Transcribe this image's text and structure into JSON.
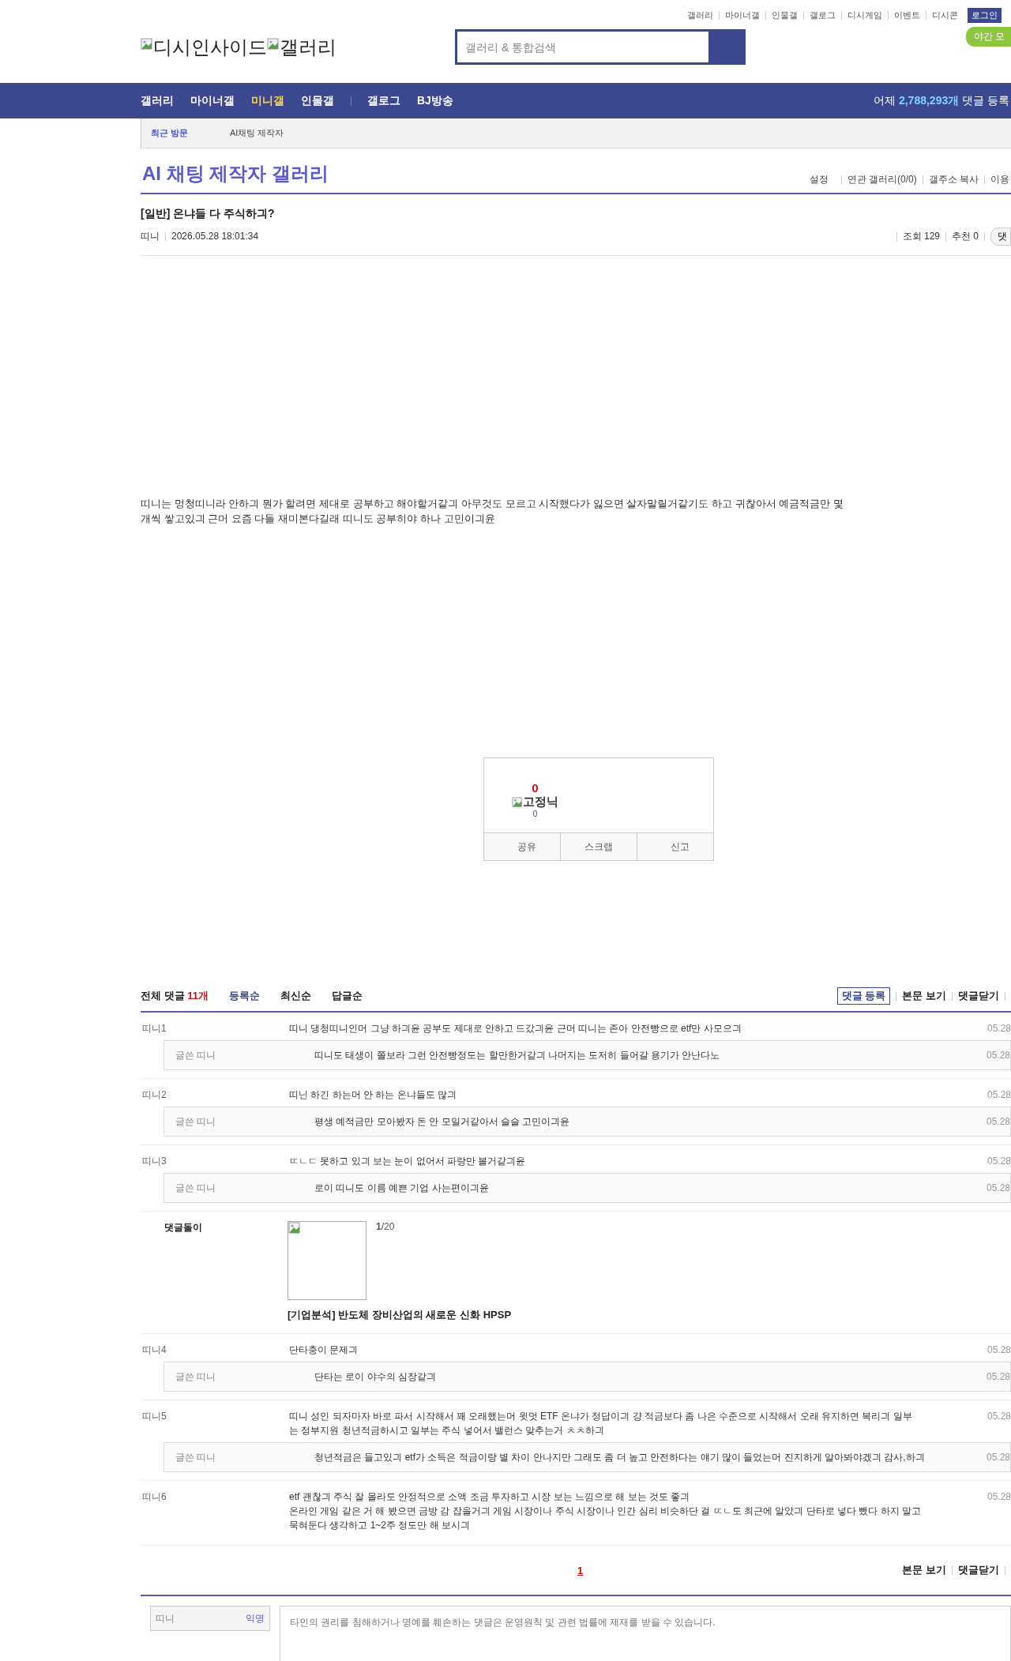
{
  "top_links": [
    "갤러리",
    "마이너갤",
    "인물갤",
    "갤로그",
    "디시게임",
    "이벤트",
    "디시콘"
  ],
  "login": "로그인",
  "night_mode": "야간 모",
  "logo": [
    "디시인사이드",
    "갤러리"
  ],
  "search": {
    "placeholder": "갤러리 & 통합검색"
  },
  "nav": [
    {
      "label": "갤러리",
      "selected": false
    },
    {
      "label": "마이너갤",
      "selected": false
    },
    {
      "label": "미니갤",
      "selected": true
    },
    {
      "label": "인물갤",
      "selected": false
    },
    {
      "label": "갤로그",
      "selected": false
    },
    {
      "label": "BJ방송",
      "selected": false
    }
  ],
  "nav_stat": {
    "prefix": "어제",
    "count": "2,788,293개",
    "suffix": "댓글 등록"
  },
  "recent": {
    "label": "최근 방문",
    "items": [
      "AI채팅 제작자"
    ]
  },
  "gallery_title": "AI 채팅 제작자 갤러리",
  "gallery_links": [
    "설정",
    "연관 갤러리(0/0)",
    "갤주소 복사",
    "이용"
  ],
  "post": {
    "title": "[일반] 온냐들 다 주식하긔?",
    "author": "띠니",
    "date": "2026.05.28 18:01:34",
    "views": "조회 129",
    "recommends": "추천 0",
    "comment_button": "댓",
    "body": "띠니는 멍청띠니라 안하긔 뭔가 할려면 제대로 공부하고 해야할거같긔 아무것도 모르고 시작했다가 잃으면 살자말릴거같기도 하고 귀찮아서 예금적금만 몇 개씩 쌓고있긔 근머 요즘 다들 재미본다길래 띠니도 공부히야 하나 고민이긔윤"
  },
  "recommend_box": {
    "up_count": "0",
    "fixed_label": "고정닉",
    "fixed_count": "0",
    "buttons": [
      "공유",
      "스크랩",
      "신고"
    ]
  },
  "comments_header": {
    "label": "전체 댓글",
    "count": "11개",
    "sorts": [
      {
        "label": "등록순",
        "selected": true
      },
      {
        "label": "최신순",
        "selected": false
      },
      {
        "label": "답글순",
        "selected": false
      }
    ],
    "actions": [
      "댓글 등록",
      "본문 보기",
      "댓글닫기"
    ]
  },
  "comments": [
    {
      "kind": "comment",
      "author": "띠니1",
      "text": "띠니 댕청띠니인머 그냥 하긔윤 공부도 제대로 안하고 드갔긔윤 근머 띠니는 존아 안전빵으로 etf만 사모으긔",
      "date": "05.28",
      "replies": [
        {
          "author": "글쓴 띠니",
          "text": "띠니도 태생이 쫄보라 그런 안전빵정도는 할만한거같긔 나머지는 도저히 들어갈 용기가 안난다노",
          "date": "05.28"
        }
      ]
    },
    {
      "kind": "comment",
      "author": "띠니2",
      "text": "띠닌 하긴 하는머 안 하는 온냐들도 많긔",
      "date": "05.28",
      "replies": [
        {
          "author": "글쓴 띠니",
          "text": "평생 예적금만 모아봤자 돈 안 모일거같아서 슬슬 고민이긔윤",
          "date": "05.28"
        }
      ]
    },
    {
      "kind": "comment",
      "author": "띠니3",
      "text": "ㄸㄴㄷ 못하고 있긔 보는 눈이 없어서 파랑만 볼거같긔윤",
      "date": "05.28",
      "replies": [
        {
          "author": "글쓴 띠니",
          "text": "로이 띠니도 이름 예쁜 기업 사는편이긔윤",
          "date": "05.28"
        }
      ]
    },
    {
      "kind": "ad",
      "author": "댓글돌이",
      "page": "1",
      "total": "/20",
      "title": "[기업분석] 반도체 장비산업의 새로운 신화 HPSP"
    },
    {
      "kind": "comment",
      "author": "띠니4",
      "text": "단타충이 문제긔",
      "date": "05.28",
      "replies": [
        {
          "author": "글쓴 띠니",
          "text": "단타는 로이 야수의 심장같긔",
          "date": "05.28"
        }
      ]
    },
    {
      "kind": "comment",
      "author": "띠니5",
      "text": "띠니 성인 되자마자 바로 파서 시작해서 꽤 오래했는머 윗멋 ETF 온냐가 정답이긔 걍 적금보다 좀 나은 수준으로 시작해서 오래 유지하면 복리긔 일부는 정부지원 청년적금하시고 일부는 주식 넣어서 밸런스 맞추는거 ㅊㅊ하긔",
      "date": "05.28",
      "replies": [
        {
          "author": "글쓴 띠니",
          "text": "청년적금은 들고있긔 etf가 소득은 적금이랑 별 차이 안나지만 그래도 좀 더 높고 안전하다는 얘기 많이 들었는머 진지하게 알아봐야겠긔 감사,하긔",
          "date": "05.28"
        }
      ]
    },
    {
      "kind": "comment",
      "author": "띠니6",
      "text": "etf 괜찮긔 주식 잘 몰라도 안정적으로 소액 조금 투자하고 시장 보는 느낌으로 해 보는 것도 좋긔\n온라인 게임 같은 거 해 봤으면 금방 감 잡을거긔 게임 시장이나 주식 시장이나 인간 심리 비슷하단 걸 ㄸㄴ도 최근에 알았긔 단타로 넣다 뺐다 하지 말고 묵혀둔다 생각하고 1~2주 정도만 해 보시긔",
      "date": "05.28"
    }
  ],
  "pagination": [
    {
      "label": "1",
      "selected": true
    }
  ],
  "bottom_actions": [
    "본문 보기",
    "댓글닫기"
  ],
  "write": {
    "name": "띠니",
    "anon": "익명",
    "placeholder": "타인의 권리를 침해하거나 명예를 훼손하는 댓글은 운영원칙 및 관련 법률에 제재를 받을 수 있습니다."
  }
}
